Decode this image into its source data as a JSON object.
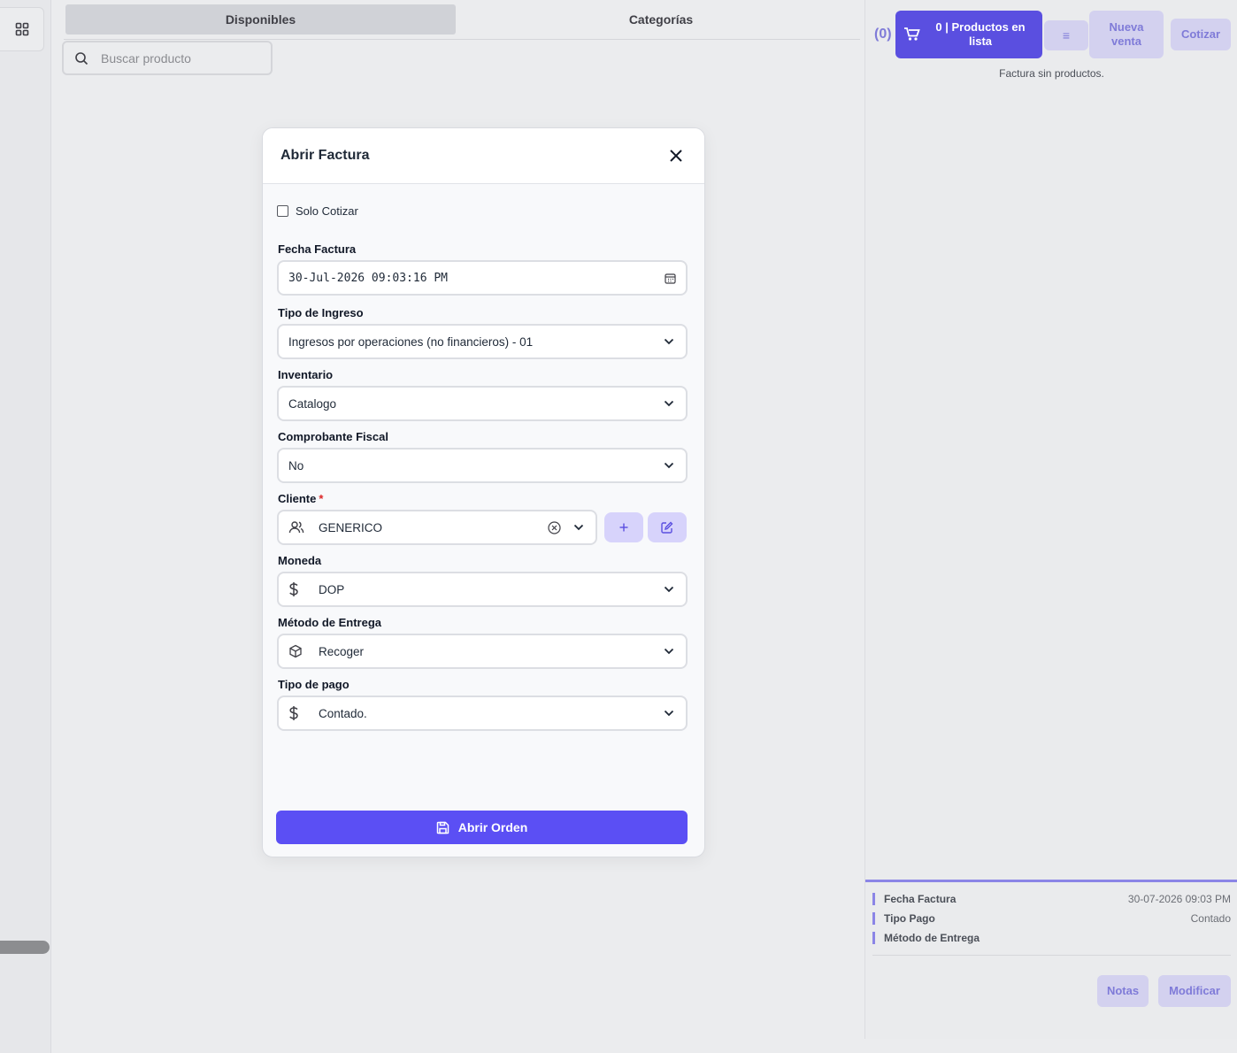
{
  "tabs": [
    "Disponibles",
    "Categorías"
  ],
  "search": {
    "placeholder": "Buscar producto"
  },
  "cart_panel": {
    "count": "(0)",
    "cart_label": "0 | Productos en lista",
    "list_button": "≡",
    "new_sale": "Nueva venta",
    "quote": "Cotizar",
    "empty_text": "Factura sin productos.",
    "summary": [
      {
        "key": "Fecha Factura",
        "value": "30-07-2026 09:03 PM"
      },
      {
        "key": "Tipo Pago",
        "value": "Contado"
      },
      {
        "key": "Método de Entrega",
        "value": ""
      }
    ],
    "notes": "Notas",
    "modify": "Modificar"
  },
  "modal": {
    "title": "Abrir Factura",
    "only_quote": "Solo Cotizar",
    "fields": {
      "fecha": {
        "label": "Fecha Factura",
        "value": "30-Jul-2026 09:03:16 PM"
      },
      "tipo_ingreso": {
        "label": "Tipo de Ingreso",
        "value": "Ingresos por operaciones (no financieros) - 01"
      },
      "inventario": {
        "label": "Inventario",
        "value": "Catalogo"
      },
      "comprobante": {
        "label": "Comprobante Fiscal",
        "value": "No"
      },
      "cliente": {
        "label": "Cliente",
        "required_mark": "*",
        "value": "GENERICO"
      },
      "moneda": {
        "label": "Moneda",
        "value": "DOP"
      },
      "entrega": {
        "label": "Método de Entrega",
        "value": "Recoger"
      },
      "tipo_pago": {
        "label": "Tipo de pago",
        "value": "Contado."
      }
    },
    "submit": "Abrir Orden"
  },
  "colors": {
    "accent": "#5b4ff4",
    "accent_soft": "#d7d3fb",
    "required": "#dc2626"
  }
}
